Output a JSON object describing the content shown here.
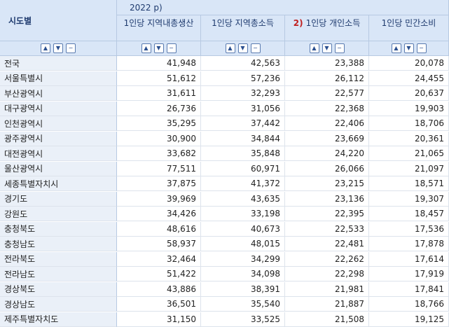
{
  "table": {
    "corner_title": "시도별",
    "period": "2022 p)",
    "columns": [
      {
        "label": "1인당 지역내총생산",
        "note": ""
      },
      {
        "label": "1인당 지역총소득",
        "note": ""
      },
      {
        "label": "1인당 개인소득",
        "note": "2)"
      },
      {
        "label": "1인당 민간소비",
        "note": ""
      }
    ],
    "rows": [
      {
        "region": "전국",
        "values": [
          "41,948",
          "42,563",
          "23,388",
          "20,078"
        ]
      },
      {
        "region": "서울특별시",
        "values": [
          "51,612",
          "57,236",
          "26,112",
          "24,455"
        ]
      },
      {
        "region": "부산광역시",
        "values": [
          "31,611",
          "32,293",
          "22,577",
          "20,637"
        ]
      },
      {
        "region": "대구광역시",
        "values": [
          "26,736",
          "31,056",
          "22,368",
          "19,903"
        ]
      },
      {
        "region": "인천광역시",
        "values": [
          "35,295",
          "37,442",
          "22,406",
          "18,706"
        ]
      },
      {
        "region": "광주광역시",
        "values": [
          "30,900",
          "34,844",
          "23,669",
          "20,361"
        ]
      },
      {
        "region": "대전광역시",
        "values": [
          "33,682",
          "35,848",
          "24,220",
          "21,065"
        ]
      },
      {
        "region": "울산광역시",
        "values": [
          "77,511",
          "60,971",
          "26,066",
          "21,097"
        ]
      },
      {
        "region": "세종특별자치시",
        "values": [
          "37,875",
          "41,372",
          "23,215",
          "18,571"
        ]
      },
      {
        "region": "경기도",
        "values": [
          "39,969",
          "43,635",
          "23,136",
          "19,307"
        ]
      },
      {
        "region": "강원도",
        "values": [
          "34,426",
          "33,198",
          "22,395",
          "18,457"
        ]
      },
      {
        "region": "충청북도",
        "values": [
          "48,616",
          "40,673",
          "22,533",
          "17,536"
        ]
      },
      {
        "region": "충청남도",
        "values": [
          "58,937",
          "48,015",
          "22,481",
          "17,878"
        ]
      },
      {
        "region": "전라북도",
        "values": [
          "32,464",
          "34,299",
          "22,262",
          "17,614"
        ]
      },
      {
        "region": "전라남도",
        "values": [
          "51,422",
          "34,098",
          "22,298",
          "17,919"
        ]
      },
      {
        "region": "경상북도",
        "values": [
          "43,886",
          "38,391",
          "21,981",
          "17,841"
        ]
      },
      {
        "region": "경상남도",
        "values": [
          "36,501",
          "35,540",
          "21,887",
          "18,766"
        ]
      },
      {
        "region": "제주특별자치도",
        "values": [
          "31,150",
          "33,525",
          "21,508",
          "19,125"
        ]
      }
    ]
  },
  "controls": {
    "sort_asc_icon": "▲",
    "sort_desc_icon": "▼",
    "remove_icon": "−"
  }
}
